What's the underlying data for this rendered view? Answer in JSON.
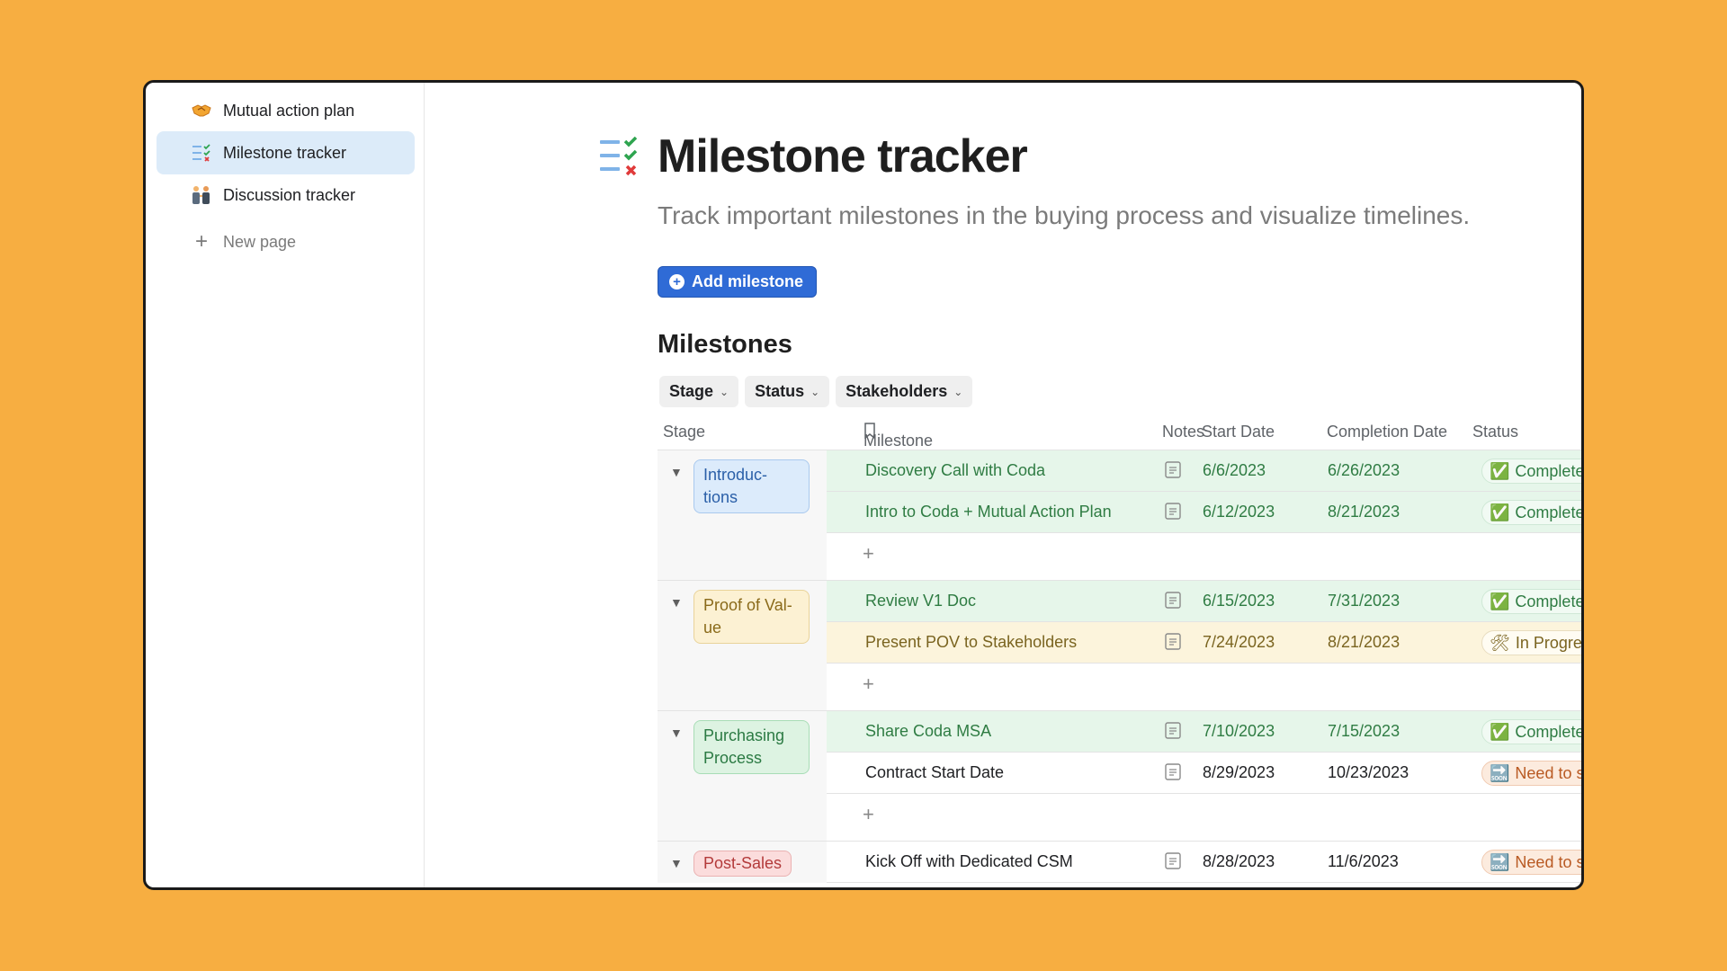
{
  "sidebar": {
    "items": [
      {
        "label": "Mutual action plan",
        "icon": "handshake-icon"
      },
      {
        "label": "Milestone tracker",
        "icon": "checklist-icon"
      },
      {
        "label": "Discussion tracker",
        "icon": "people-icon"
      }
    ],
    "new_page": "New page"
  },
  "page": {
    "title": "Milestone tracker",
    "subtitle": "Track important milestones in the buying process and visualize timelines.",
    "add_button": "Add milestone",
    "section_title": "Milestones",
    "filters": [
      "Stage",
      "Status",
      "Stakeholders"
    ]
  },
  "table": {
    "headers": {
      "stage": "Stage",
      "milestone": "Milestone",
      "notes": "Notes",
      "start": "Start Date",
      "completion": "Completion Date",
      "status": "Status"
    },
    "groups": [
      {
        "stage": "Introduc-\ntions",
        "color": "blue",
        "rows": [
          {
            "milestone": "Discovery Call with Coda",
            "start": "6/6/2023",
            "completion": "6/26/2023",
            "status": "Completed"
          },
          {
            "milestone": "Intro to Coda + Mutual Action Plan",
            "start": "6/12/2023",
            "completion": "8/21/2023",
            "status": "Completed"
          }
        ]
      },
      {
        "stage": "Proof of Val-\nue",
        "color": "yellow",
        "rows": [
          {
            "milestone": "Review V1 Doc",
            "start": "6/15/2023",
            "completion": "7/31/2023",
            "status": "Completed"
          },
          {
            "milestone": "Present POV to Stakeholders",
            "start": "7/24/2023",
            "completion": "8/21/2023",
            "status": "In Progress"
          }
        ]
      },
      {
        "stage": "Purchasing\nProcess",
        "color": "green",
        "rows": [
          {
            "milestone": "Share Coda MSA",
            "start": "7/10/2023",
            "completion": "7/15/2023",
            "status": "Completed"
          },
          {
            "milestone": "Contract Start Date",
            "start": "8/29/2023",
            "completion": "10/23/2023",
            "status": "Need to start"
          }
        ]
      },
      {
        "stage": "Post-Sales",
        "color": "red",
        "rows": [
          {
            "milestone": "Kick Off with Dedicated CSM",
            "start": "8/28/2023",
            "completion": "11/6/2023",
            "status": "Need to start"
          }
        ]
      }
    ],
    "add_row_symbol": "+"
  },
  "status_icons": {
    "Completed": "✅",
    "In Progress": "🛠",
    "Need to start": "🔜"
  },
  "colors": {
    "accent": "#2F6BD6",
    "background": "#F7AE41"
  }
}
